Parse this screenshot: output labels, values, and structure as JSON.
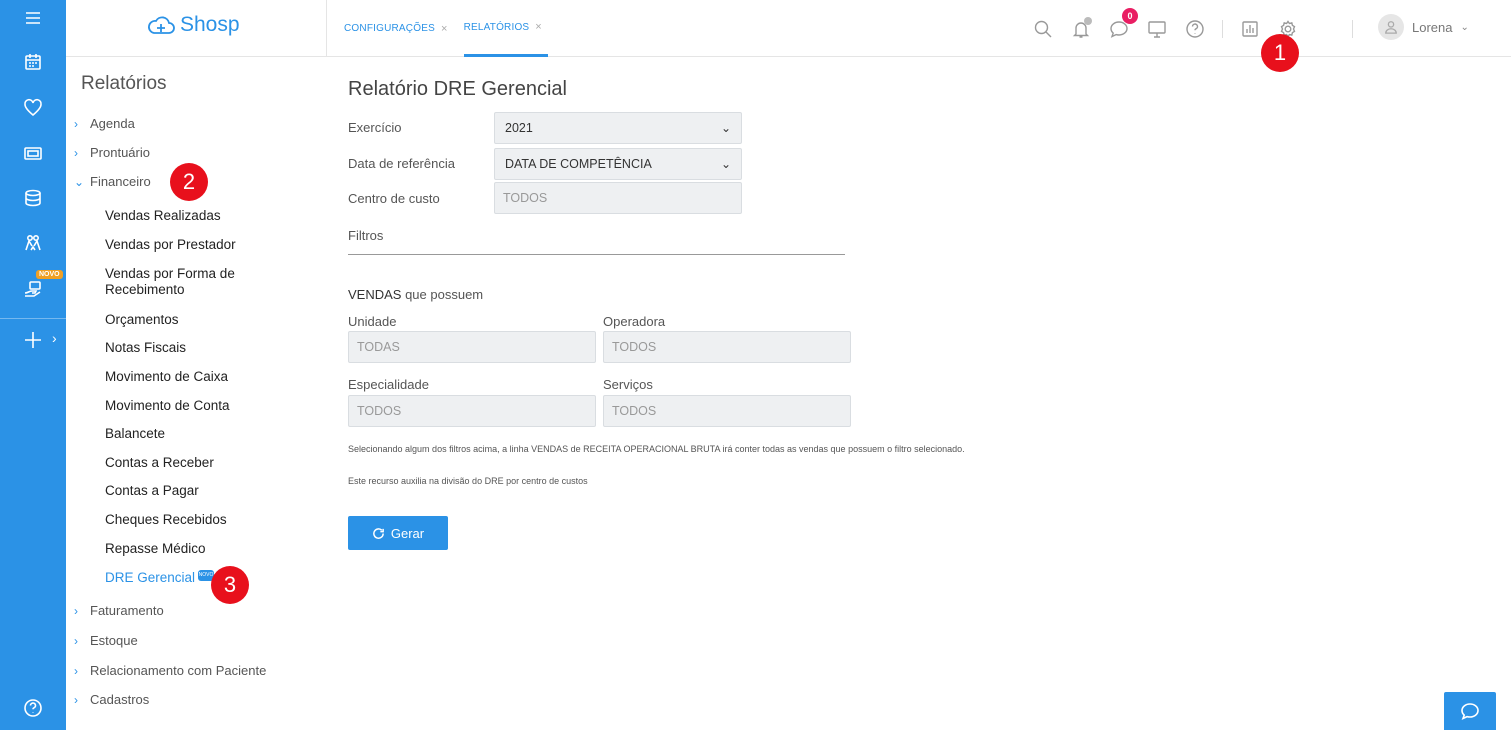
{
  "app": {
    "logo_text": "Shosp",
    "brand_color": "#2b92e6",
    "marker_color": "#e8101c"
  },
  "rail": {
    "icons": [
      "menu-icon",
      "calendar-icon",
      "heart-icon",
      "money-icon",
      "database-icon",
      "people-icon",
      "hand-card-icon",
      "plus-icon",
      "help-icon"
    ],
    "novo_badge": "NOVO"
  },
  "tabs": [
    {
      "label": "CONFIGURAÇÕES",
      "close": "×"
    },
    {
      "label": "RELATÓRIOS",
      "close": "×"
    }
  ],
  "header": {
    "messages_badge": "0",
    "user_name": "Lorena",
    "user_chevron": "⌄",
    "icons": [
      "search-icon",
      "bell-icon",
      "chat-icon",
      "monitor-icon",
      "help-icon",
      "reports-icon",
      "gear-icon",
      "user-icon"
    ]
  },
  "markers": [
    "1",
    "2",
    "3"
  ],
  "side": {
    "title": "Relatórios",
    "groups": [
      "Agenda",
      "Prontuário",
      "Financeiro",
      "Faturamento",
      "Estoque",
      "Relacionamento com Paciente",
      "Cadastros"
    ],
    "financeiro_items": [
      "Vendas Realizadas",
      "Vendas por Prestador",
      "Vendas por Forma de",
      "Recebimento",
      "Orçamentos",
      "Notas Fiscais",
      "Movimento de Caixa",
      "Movimento de Conta",
      "Balancete",
      "Contas a Receber",
      "Contas a Pagar",
      "Cheques Recebidos",
      "Repasse Médico",
      "DRE Gerencial"
    ],
    "dre_badge": "NOVO"
  },
  "main": {
    "title": "Relatório DRE Gerencial",
    "exercicio_label": "Exercício",
    "exercicio_value": "2021",
    "data_ref_label": "Data de referência",
    "data_ref_value": "DATA DE COMPETÊNCIA",
    "centro_label": "Centro de custo",
    "centro_value": "TODOS",
    "filtros_label": "Filtros",
    "vendas_bold": "VENDAS",
    "vendas_rest": " que possuem",
    "unidade_label": "Unidade",
    "unidade_value": "TODAS",
    "operadora_label": "Operadora",
    "operadora_value": "TODOS",
    "especialidade_label": "Especialidade",
    "especialidade_value": "TODOS",
    "servicos_label": "Serviços",
    "servicos_value": "TODOS",
    "note1": "Selecionando algum dos filtros acima, a linha VENDAS de RECEITA OPERACIONAL BRUTA irá conter todas as vendas que possuem o filtro selecionado.",
    "note2": "Este recurso auxilia na divisão do DRE por centro de custos",
    "button_label": "Gerar"
  }
}
